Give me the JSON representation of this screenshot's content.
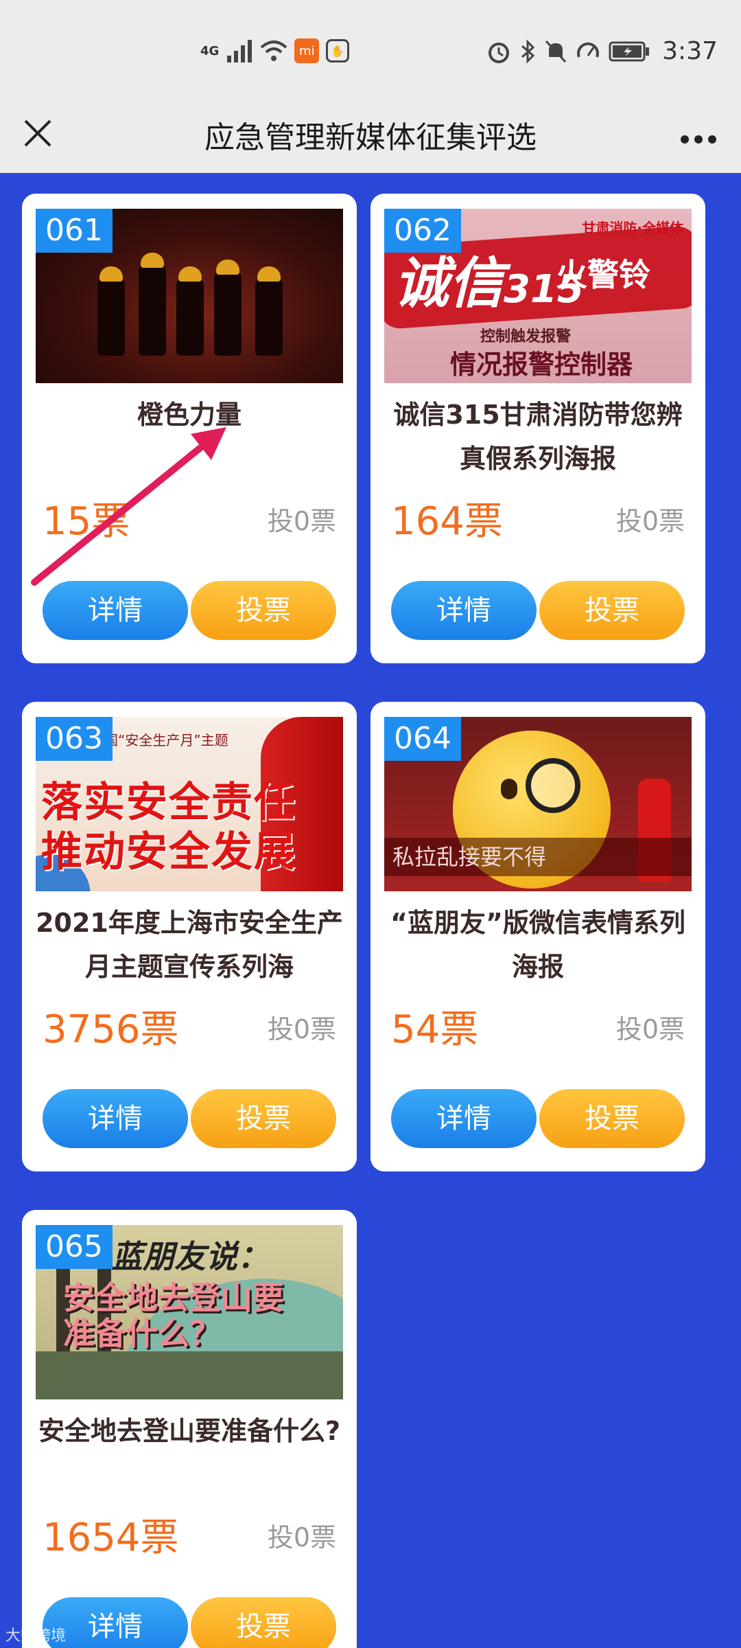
{
  "statusbar": {
    "network": "4G",
    "time": "3:37",
    "mi_badge": "mi"
  },
  "header": {
    "title": "应急管理新媒体征集评选"
  },
  "cards": [
    {
      "num": "061",
      "title": "橙色力量",
      "votes": "15票",
      "my_vote": "投0票",
      "detail_label": "详情",
      "vote_label": "投票"
    },
    {
      "num": "062",
      "title": "诚信315甘肃消防带您辨真假系列海报",
      "votes": "164票",
      "my_vote": "投0票",
      "detail_label": "详情",
      "vote_label": "投票",
      "image_text": {
        "big": "诚信",
        "num": "315",
        "right": "火警铃",
        "logo": "甘肃消防·全媒体",
        "sub1": "控制触发报警",
        "sub2": "情况报警控制器"
      }
    },
    {
      "num": "063",
      "title": "2021年度上海市安全生产月主题宣传系列海",
      "votes": "3756票",
      "my_vote": "投0票",
      "detail_label": "详情",
      "vote_label": "投票",
      "image_text": {
        "top": "全国“安全生产月”主题",
        "line1": "落实安全责任",
        "line2": "推动安全发展"
      }
    },
    {
      "num": "064",
      "title": "“蓝朋友”版微信表情系列海报",
      "votes": "54票",
      "my_vote": "投0票",
      "detail_label": "详情",
      "vote_label": "投票",
      "image_text": {
        "strip": "私拉乱接要不得"
      }
    },
    {
      "num": "065",
      "title": "安全地去登山要准备什么?",
      "votes": "1654票",
      "my_vote": "投0票",
      "detail_label": "详情",
      "vote_label": "投票",
      "image_text": {
        "top": "蓝朋友说：",
        "main": "安全地去登山要准备什么？"
      }
    }
  ],
  "watermark": "大数跨境",
  "colors": {
    "page_bg": "#2a48d8",
    "number_badge": "#1e8ff0",
    "votes_text": "#f26d1e",
    "detail_button": "#1a7fe8",
    "vote_button": "#f8a013",
    "annotation_arrow": "#e01e5a"
  }
}
